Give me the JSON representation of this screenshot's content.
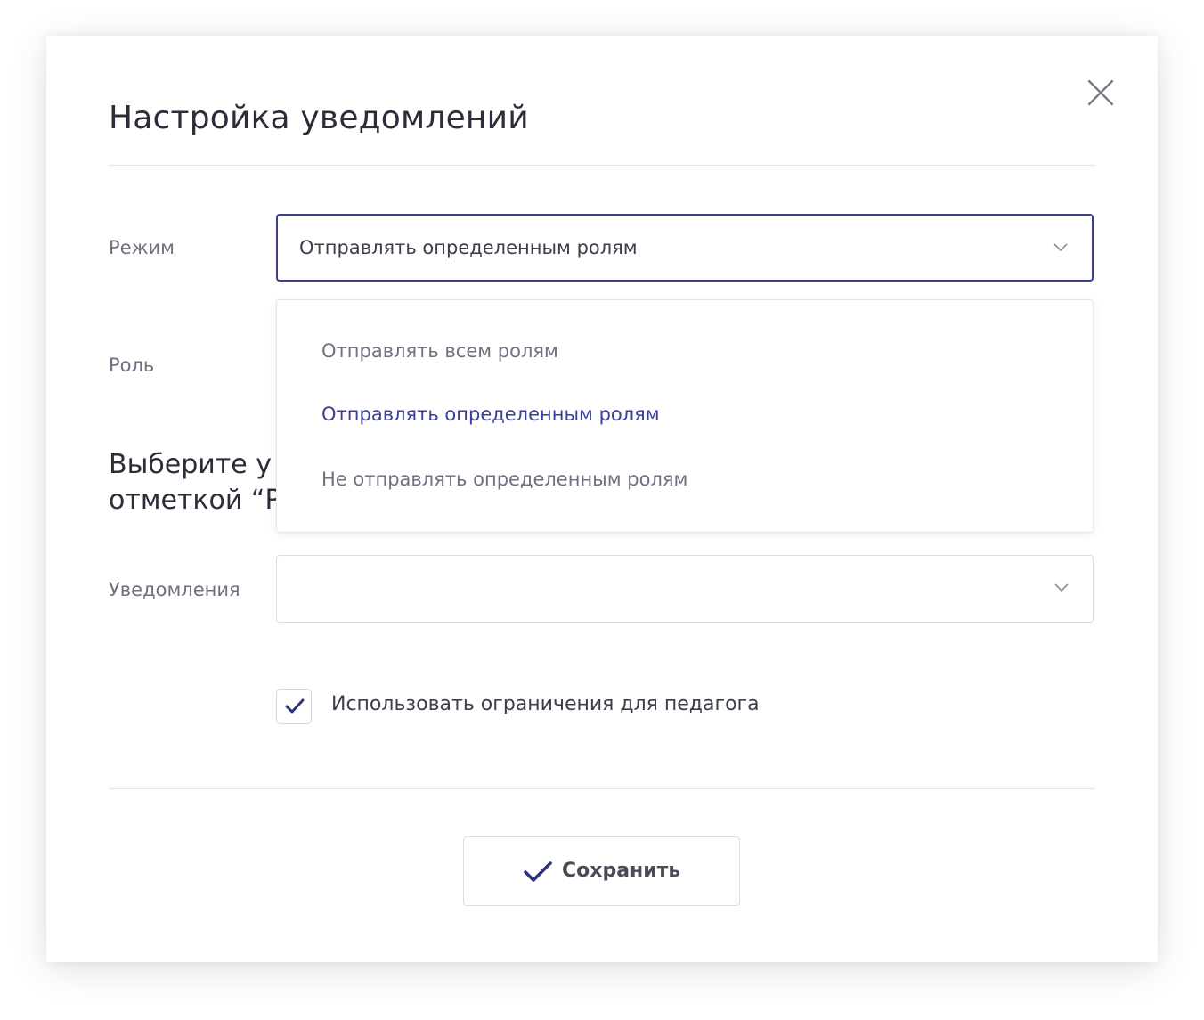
{
  "modal": {
    "title": "Настройка уведомлений"
  },
  "fields": {
    "mode_label": "Режим",
    "mode_value": "Отправлять определенным ролям",
    "role_label": "Роль",
    "notifications_label": "Уведомления",
    "notifications_value": ""
  },
  "section": {
    "heading_line1": "Выберите у",
    "heading_line2": "отметкой “Р"
  },
  "dropdown": {
    "options": [
      {
        "label": "Отправлять всем ролям",
        "selected": false
      },
      {
        "label": "Отправлять определенным ролям",
        "selected": true
      },
      {
        "label": "Не отправлять определенным ролям",
        "selected": false
      }
    ]
  },
  "checkbox": {
    "label": "Использовать ограничения для педагога",
    "checked": true
  },
  "footer": {
    "save_label": "Сохранить"
  },
  "colors": {
    "accent": "#3a3f9a",
    "text_primary": "#2b2d3a",
    "text_secondary": "#6f7180",
    "border": "#dcdde3"
  },
  "icons": [
    "close-icon",
    "chevron-down-icon",
    "checkmark-icon"
  ]
}
